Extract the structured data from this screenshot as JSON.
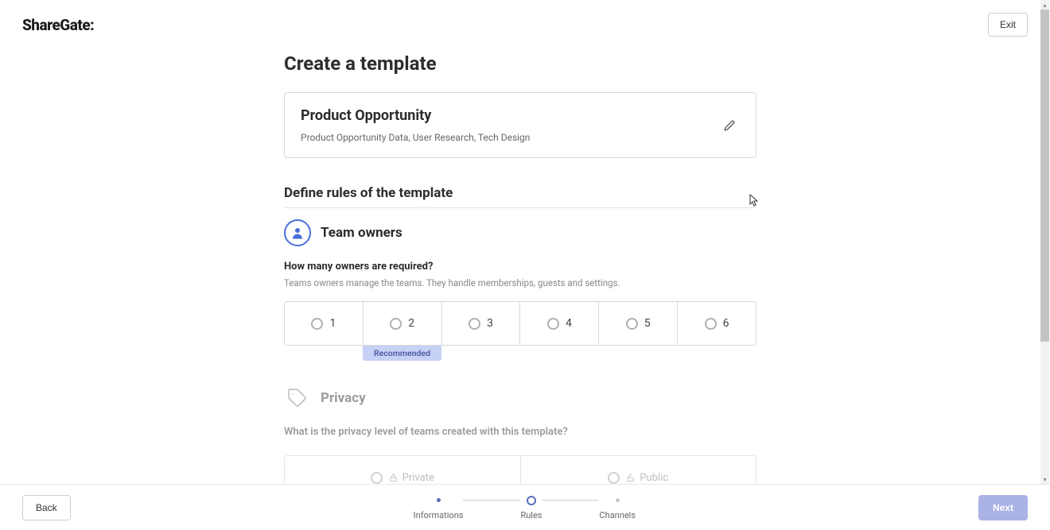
{
  "header": {
    "logo": "ShareGate:",
    "exit_label": "Exit"
  },
  "page": {
    "title": "Create a template"
  },
  "template": {
    "name": "Product Opportunity",
    "tags": "Product Opportunity Data, User Research, Tech Design"
  },
  "rules": {
    "section_title": "Define rules of the template",
    "owners": {
      "title": "Team owners",
      "question": "How many owners are required?",
      "helper": "Teams owners manage the teams. They handle memberships, guests and settings.",
      "options": [
        "1",
        "2",
        "3",
        "4",
        "5",
        "6"
      ],
      "recommended_label": "Recommended",
      "recommended_index": 1
    },
    "privacy": {
      "title": "Privacy",
      "question": "What is the privacy level of teams created with this template?",
      "options": [
        {
          "label": "Private",
          "icon": "lock"
        },
        {
          "label": "Public",
          "icon": "unlock"
        }
      ]
    }
  },
  "footer": {
    "back_label": "Back",
    "next_label": "Next",
    "steps": [
      {
        "label": "Informations",
        "state": "done"
      },
      {
        "label": "Rules",
        "state": "active"
      },
      {
        "label": "Channels",
        "state": "future"
      }
    ]
  }
}
